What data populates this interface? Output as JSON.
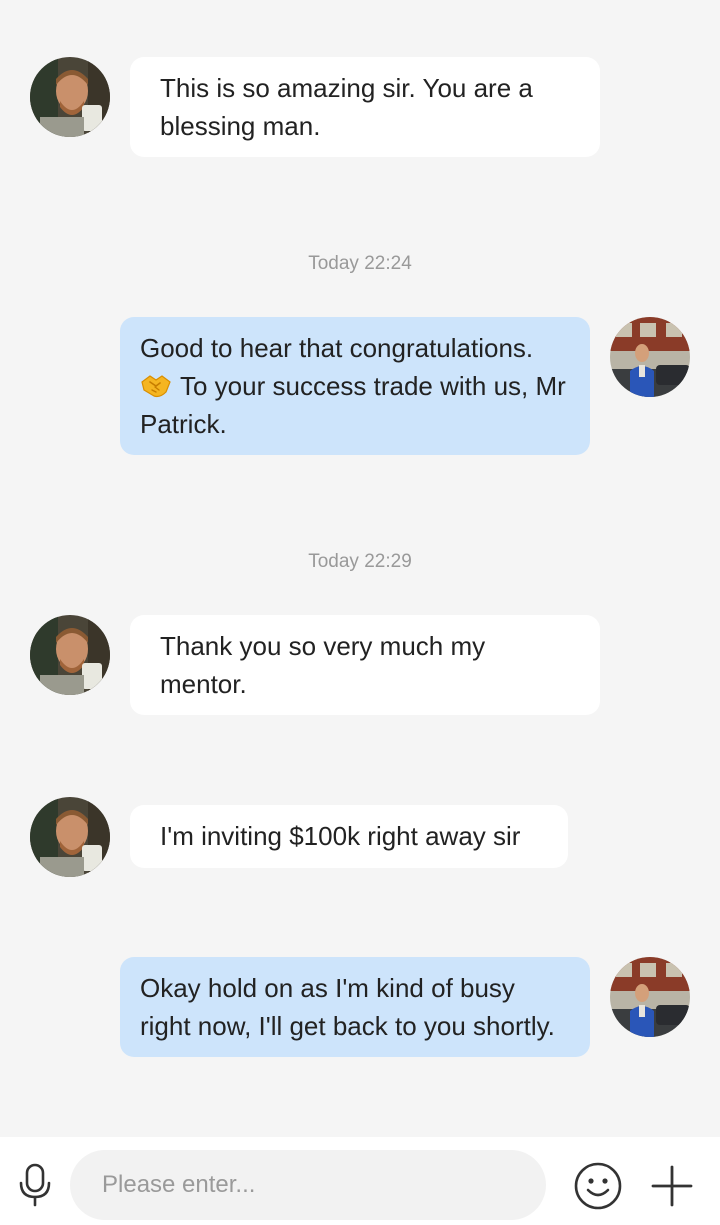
{
  "messages": [
    {
      "type": "incoming",
      "text": "This is so amazing sir. You are a blessing man."
    },
    {
      "type": "timestamp",
      "text": "Today 22:24"
    },
    {
      "type": "outgoing",
      "emoji": "handshake",
      "text_before_emoji": "Good to hear that congratulations.",
      "text_after_emoji": "To your success trade with us, Mr Patrick."
    },
    {
      "type": "timestamp",
      "text": "Today 22:29"
    },
    {
      "type": "incoming",
      "text": "Thank you so very much my mentor."
    },
    {
      "type": "incoming",
      "text": "I'm inviting $100k right away sir"
    },
    {
      "type": "outgoing",
      "text": "Okay hold on as I'm kind of busy right now, I'll get back to you shortly."
    }
  ],
  "input_bar": {
    "placeholder": "Please enter...",
    "icons": [
      "microphone-icon",
      "smiley-icon",
      "plus-icon"
    ]
  },
  "colors": {
    "background": "#f5f5f5",
    "incoming_bubble": "#ffffff",
    "outgoing_bubble": "#cde4fb",
    "timestamp_text": "#999999",
    "message_text": "#222222"
  }
}
